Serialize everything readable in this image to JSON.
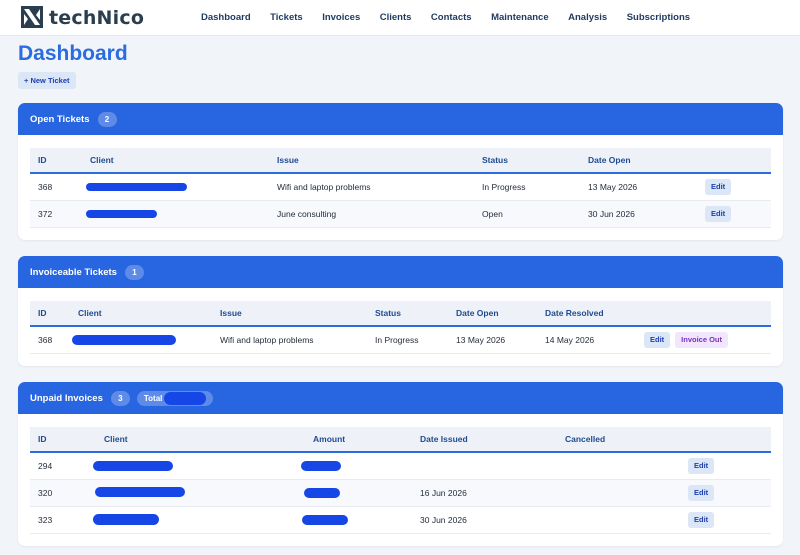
{
  "brand": {
    "name": "techNico"
  },
  "nav": [
    "Dashboard",
    "Tickets",
    "Invoices",
    "Clients",
    "Contacts",
    "Maintenance",
    "Analysis",
    "Subscriptions"
  ],
  "page": {
    "title": "Dashboard",
    "new_ticket": "+ New Ticket"
  },
  "open_tickets": {
    "title": "Open Tickets",
    "count": "2",
    "columns": [
      "ID",
      "Client",
      "Issue",
      "Status",
      "Date Open"
    ],
    "rows": [
      {
        "id": "368",
        "issue": "Wifi and laptop problems",
        "status": "In Progress",
        "date_open": "13 May 2026",
        "edit": "Edit"
      },
      {
        "id": "372",
        "issue": "June consulting",
        "status": "Open",
        "date_open": "30 Jun 2026",
        "edit": "Edit"
      }
    ]
  },
  "invoiceable_tickets": {
    "title": "Invoiceable Tickets",
    "count": "1",
    "columns": [
      "ID",
      "Client",
      "Issue",
      "Status",
      "Date Open",
      "Date Resolved"
    ],
    "rows": [
      {
        "id": "368",
        "issue": "Wifi and laptop problems",
        "status": "In Progress",
        "date_open": "13 May 2026",
        "date_resolved": "14 May 2026",
        "edit": "Edit",
        "invoice_out": "Invoice Out"
      }
    ]
  },
  "unpaid_invoices": {
    "title": "Unpaid Invoices",
    "count": "3",
    "total_label": "Total",
    "columns": [
      "ID",
      "Client",
      "Amount",
      "Date Issued",
      "Cancelled"
    ],
    "rows": [
      {
        "id": "294",
        "date_issued": "",
        "edit": "Edit"
      },
      {
        "id": "320",
        "date_issued": "16 Jun 2026",
        "edit": "Edit"
      },
      {
        "id": "323",
        "date_issued": "30 Jun 2026",
        "edit": "Edit"
      }
    ]
  },
  "colors": {
    "primary": "#2865e0",
    "redaction": "#1746e6",
    "title": "#2b6cdf"
  }
}
